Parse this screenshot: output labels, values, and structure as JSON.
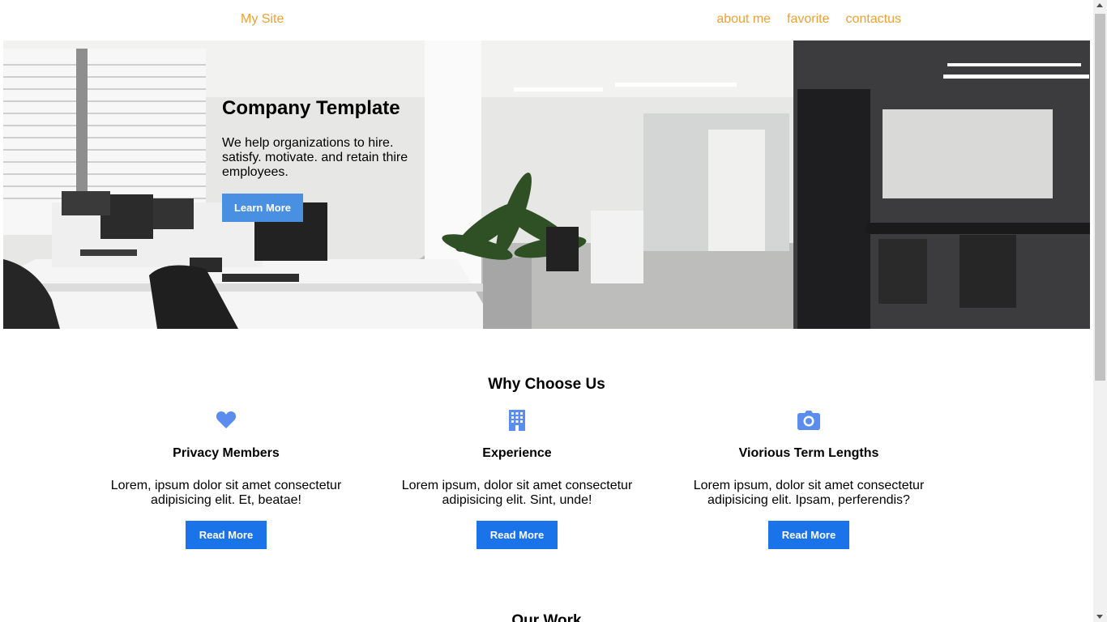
{
  "header": {
    "brand": "My Site",
    "nav": [
      "about me",
      "favorite",
      "contactus"
    ]
  },
  "hero": {
    "title": "Company Template",
    "text": "We help organizations to hire. satisfy. motivate. and retain thire employees.",
    "button": "Learn More"
  },
  "why": {
    "title": "Why Choose Us",
    "features": [
      {
        "icon": "heart-icon",
        "title": "Privacy Members",
        "text": "Lorem, ipsum dolor sit amet consectetur adipisicing elit. Et, beatae!",
        "button": "Read More"
      },
      {
        "icon": "building-icon",
        "title": "Experience",
        "text": "Lorem ipsum, dolor sit amet consectetur adipisicing elit. Sint, unde!",
        "button": "Read More"
      },
      {
        "icon": "camera-icon",
        "title": "Viorious Term Lengths",
        "text": "Lorem ipsum, dolor sit amet consectetur adipisicing elit. Ipsam, perferendis?",
        "button": "Read More"
      }
    ]
  },
  "work": {
    "title": "Our Work"
  },
  "colors": {
    "nav": "#f0a030",
    "icon": "#5b8def",
    "button": "#1a73e8",
    "hero_button": "#4a90e2"
  }
}
